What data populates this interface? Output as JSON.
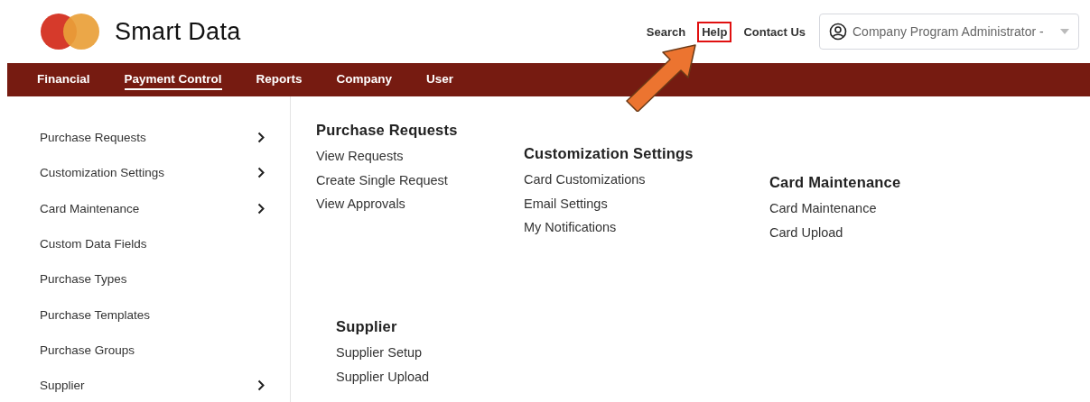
{
  "header": {
    "logo_text": "Smart Data",
    "links": [
      {
        "label": "Search",
        "highlighted": false
      },
      {
        "label": "Help",
        "highlighted": true
      },
      {
        "label": "Contact Us",
        "highlighted": false
      }
    ],
    "account_dropdown": {
      "value": "Company Program Administrator -"
    }
  },
  "nav": [
    {
      "label": "Financial",
      "selected": false
    },
    {
      "label": "Payment Control",
      "selected": true
    },
    {
      "label": "Reports",
      "selected": false
    },
    {
      "label": "Company",
      "selected": false
    },
    {
      "label": "User",
      "selected": false
    }
  ],
  "sidebar": {
    "items": [
      {
        "label": "Purchase Requests",
        "has_submenu": true
      },
      {
        "label": "Customization Settings",
        "has_submenu": true
      },
      {
        "label": "Card Maintenance",
        "has_submenu": true
      },
      {
        "label": "Custom Data Fields",
        "has_submenu": false
      },
      {
        "label": "Purchase Types",
        "has_submenu": false
      },
      {
        "label": "Purchase Templates",
        "has_submenu": false
      },
      {
        "label": "Purchase Groups",
        "has_submenu": false
      },
      {
        "label": "Supplier",
        "has_submenu": true
      }
    ]
  },
  "menu_groups": [
    {
      "title": "Purchase Requests",
      "links": [
        "View Requests",
        "Create Single Request",
        "View Approvals"
      ]
    },
    {
      "title": "Customization Settings",
      "links": [
        "Card Customizations",
        "Email Settings",
        "My Notifications"
      ]
    },
    {
      "title": "Card Maintenance",
      "links": [
        "Card Maintenance",
        "Card Upload"
      ]
    },
    {
      "title": "Supplier",
      "links": [
        "Supplier Setup",
        "Supplier Upload"
      ]
    }
  ],
  "annotation": {
    "kind": "arrow"
  }
}
